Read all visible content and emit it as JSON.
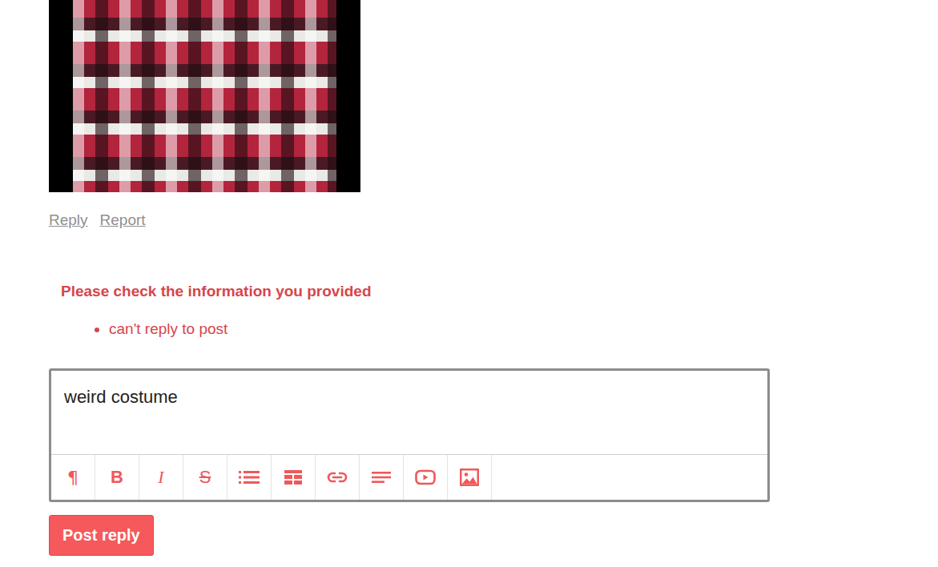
{
  "post_actions": [
    {
      "label": "Reply"
    },
    {
      "label": "Report"
    }
  ],
  "error": {
    "title": "Please check the information you provided",
    "items": [
      "can't reply to post"
    ]
  },
  "editor": {
    "value": "weird costume",
    "toolbar": [
      {
        "kind": "glyph",
        "glyph": "¶"
      },
      {
        "kind": "glyph",
        "glyph": "B"
      },
      {
        "kind": "glyph",
        "glyph": "I"
      },
      {
        "kind": "glyph",
        "glyph": "S"
      },
      {
        "kind": "list"
      },
      {
        "kind": "table"
      },
      {
        "kind": "link"
      },
      {
        "kind": "align"
      },
      {
        "kind": "video"
      },
      {
        "kind": "image"
      }
    ]
  },
  "submit": {
    "label": "Post reply"
  }
}
